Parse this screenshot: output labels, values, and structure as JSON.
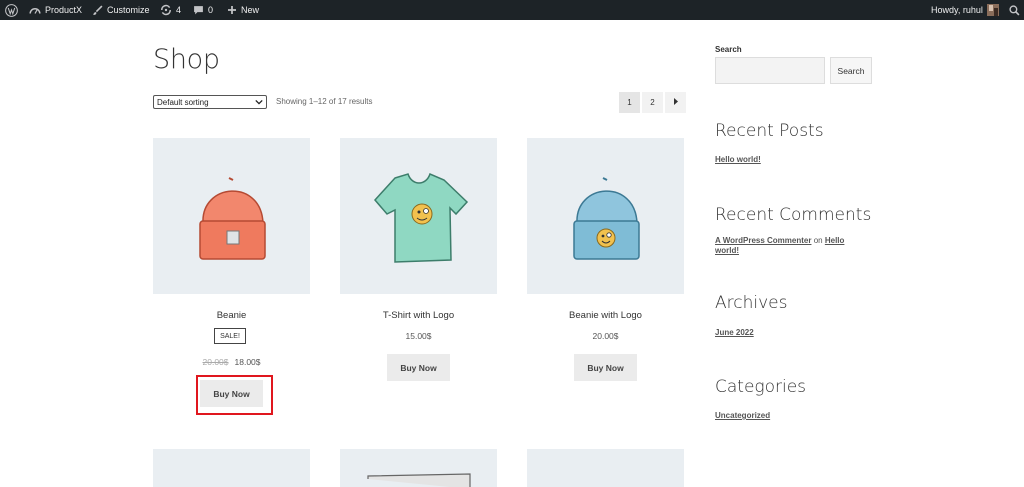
{
  "adminbar": {
    "site_name": "ProductX",
    "customize": "Customize",
    "updates_count": "4",
    "comments_count": "0",
    "new_label": "New",
    "greeting": "Howdy, ruhul"
  },
  "shop": {
    "title": "Shop",
    "sorting_selected": "Default sorting",
    "results_text": "Showing 1–12 of 17 results",
    "pages": [
      "1",
      "2"
    ]
  },
  "products": [
    {
      "name": "Beanie",
      "sale_badge": "SALE!",
      "old_price": "20.00$",
      "price": "18.00$",
      "button": "Buy Now",
      "image": "beanie-orange-icon"
    },
    {
      "name": "T-Shirt with Logo",
      "price": "15.00$",
      "button": "Buy Now",
      "image": "tshirt-green-icon"
    },
    {
      "name": "Beanie with Logo",
      "price": "20.00$",
      "button": "Buy Now",
      "image": "beanie-blue-icon"
    }
  ],
  "sidebar": {
    "search_label": "Search",
    "search_button": "Search",
    "recent_posts_title": "Recent Posts",
    "recent_posts": [
      "Hello world!"
    ],
    "recent_comments_title": "Recent Comments",
    "comment_author": "A WordPress Commenter",
    "comment_on": "on",
    "comment_post": "Hello world!",
    "archives_title": "Archives",
    "archives": [
      "June 2022"
    ],
    "categories_title": "Categories",
    "categories": [
      "Uncategorized"
    ]
  },
  "colors": {
    "adminbar_bg": "#1d2327",
    "thumb_bg": "#e9eef2",
    "highlight": "#e0171e"
  }
}
